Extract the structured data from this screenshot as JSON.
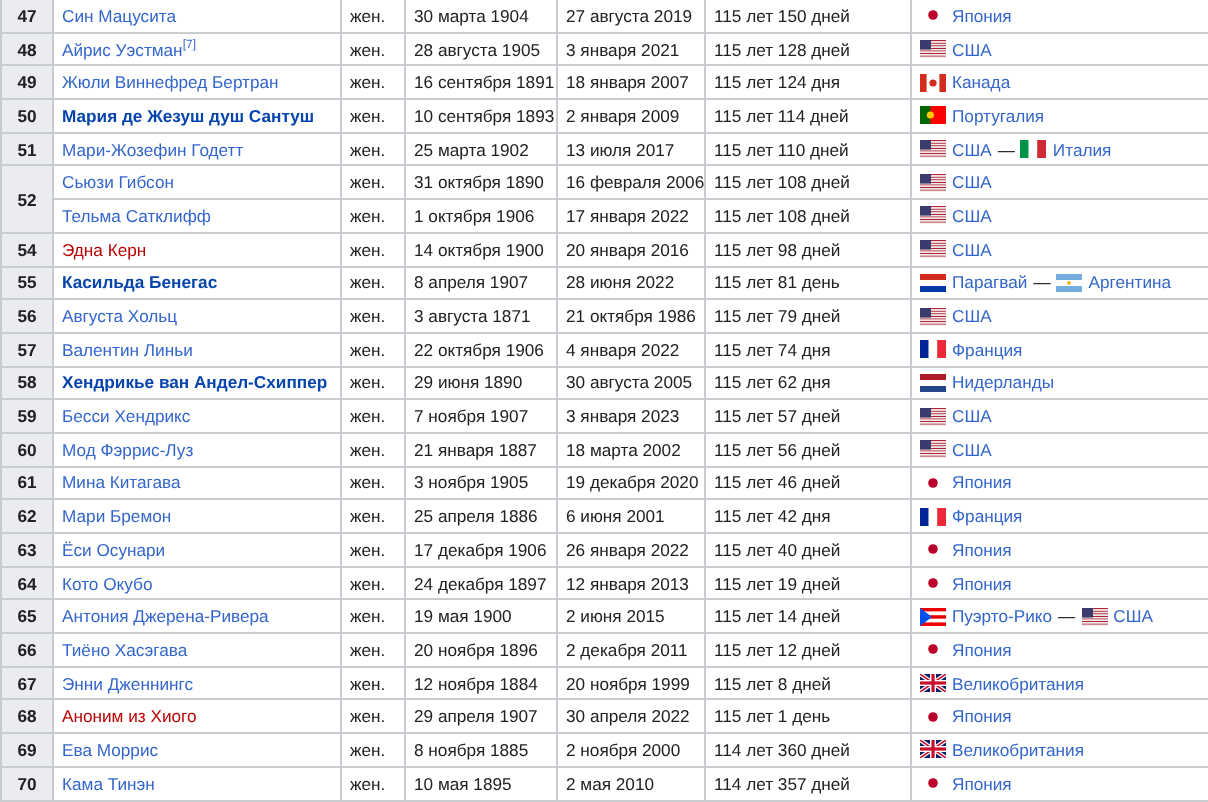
{
  "rows": [
    {
      "rank": "47",
      "people": [
        {
          "name": "Син Мацусита",
          "kind": "normal",
          "sex": "жен.",
          "born": "30 марта 1904",
          "died": "27 августа 2019",
          "age": "115 лет 150 дней",
          "countries": [
            {
              "kind": "japan",
              "name": "Япония"
            }
          ]
        }
      ]
    },
    {
      "rank": "48",
      "people": [
        {
          "name": "Айрис Уэстман$^{[7]}$",
          "kind": "normal",
          "sex": "жен.",
          "born": "28 августа 1905",
          "died": "3 января 2021",
          "age": "115 лет 128 дней",
          "countries": [
            {
              "kind": "usa",
              "name": "США"
            }
          ]
        }
      ]
    },
    {
      "rank": "49",
      "people": [
        {
          "name": "Жюли Виннефред Бертран",
          "kind": "normal",
          "sex": "жен.",
          "born": "16 сентября 1891",
          "died": "18 января 2007",
          "age": "115 лет 124 дня",
          "countries": [
            {
              "kind": "canada",
              "name": "Канада"
            }
          ]
        }
      ]
    },
    {
      "rank": "50",
      "people": [
        {
          "name": "Мария де Жезуш душ Сантуш",
          "kind": "highlighted",
          "sex": "жен.",
          "born": "10 сентября 1893",
          "died": "2 января 2009",
          "age": "115 лет 114 дней",
          "countries": [
            {
              "kind": "portugal",
              "name": "Португалия"
            }
          ]
        }
      ]
    },
    {
      "rank": "51",
      "people": [
        {
          "name": "Мари-Жозефин Годетт",
          "kind": "normal",
          "sex": "жен.",
          "born": "25 марта 1902",
          "died": "13 июля 2017",
          "age": "115 лет 110 дней",
          "countries": [
            {
              "kind": "usa",
              "name": "США"
            },
            {
              "separator": "—",
              "kind": "italy",
              "name": "Италия"
            }
          ]
        }
      ]
    },
    {
      "rank": "52",
      "people": [
        {
          "name": "Сьюзи Гибсон",
          "kind": "normal",
          "sex": "жен.",
          "born": "31 октября 1890",
          "died": "16 февраля 2006",
          "age": "115 лет 108 дней",
          "countries": [
            {
              "kind": "usa",
              "name": "США"
            }
          ]
        },
        {
          "name": "Тельма Сатклифф",
          "kind": "normal",
          "sex": "жен.",
          "born": "1 октября 1906",
          "died": "17 января 2022",
          "age": "115 лет 108 дней",
          "countries": [
            {
              "kind": "usa",
              "name": "США"
            }
          ]
        }
      ]
    },
    {
      "rank": "54",
      "people": [
        {
          "name": "Эдна Керн",
          "kind": "missing",
          "sex": "жен.",
          "born": "14 октября 1900",
          "died": "20 января 2016",
          "age": "115 лет 98 дней",
          "countries": [
            {
              "kind": "usa",
              "name": "США"
            }
          ]
        }
      ]
    },
    {
      "rank": "55",
      "people": [
        {
          "name": "Касильда Бенегас",
          "kind": "highlighted",
          "sex": "жен.",
          "born": "8 апреля 1907",
          "died": "28 июня 2022",
          "age": "115 лет 81 день",
          "countries": [
            {
              "kind": "paraguay",
              "name": "Парагвай"
            },
            {
              "separator": "—",
              "kind": "argentina",
              "name": "Аргентина"
            }
          ]
        }
      ]
    },
    {
      "rank": "56",
      "people": [
        {
          "name": "Августа Хольц",
          "kind": "normal",
          "sex": "жен.",
          "born": "3 августа 1871",
          "died": "21 октября 1986",
          "age": "115 лет 79 дней",
          "countries": [
            {
              "kind": "usa",
              "name": "США"
            }
          ]
        }
      ]
    },
    {
      "rank": "57",
      "people": [
        {
          "name": "Валентин Линьи",
          "kind": "normal",
          "sex": "жен.",
          "born": "22 октября 1906",
          "died": "4 января 2022",
          "age": "115 лет 74 дня",
          "countries": [
            {
              "kind": "france",
              "name": "Франция"
            }
          ]
        }
      ]
    },
    {
      "rank": "58",
      "people": [
        {
          "name": "Хендрикье ван Андел-Схиппер",
          "kind": "highlighted",
          "sex": "жен.",
          "born": "29 июня 1890",
          "died": "30 августа 2005",
          "age": "115 лет 62 дня",
          "countries": [
            {
              "kind": "netherlands",
              "name": "Нидерланды"
            }
          ]
        }
      ]
    },
    {
      "rank": "59",
      "people": [
        {
          "name": "Бесси Хендрикс",
          "kind": "normal",
          "sex": "жен.",
          "born": "7 ноября 1907",
          "died": "3 января 2023",
          "age": "115 лет 57 дней",
          "countries": [
            {
              "kind": "usa",
              "name": "США"
            }
          ]
        }
      ]
    },
    {
      "rank": "60",
      "people": [
        {
          "name": "Мод Фэррис-Луз",
          "kind": "normal",
          "sex": "жен.",
          "born": "21 января 1887",
          "died": "18 марта 2002",
          "age": "115 лет 56 дней",
          "countries": [
            {
              "kind": "usa",
              "name": "США"
            }
          ]
        }
      ]
    },
    {
      "rank": "61",
      "people": [
        {
          "name": "Мина Китагава",
          "kind": "normal",
          "sex": "жен.",
          "born": "3 ноября 1905",
          "died": "19 декабря 2020",
          "age": "115 лет 46 дней",
          "countries": [
            {
              "kind": "japan",
              "name": "Япония"
            }
          ]
        }
      ]
    },
    {
      "rank": "62",
      "people": [
        {
          "name": "Мари Бремон",
          "kind": "normal",
          "sex": "жен.",
          "born": "25 апреля 1886",
          "died": "6 июня 2001",
          "age": "115 лет 42 дня",
          "countries": [
            {
              "kind": "france",
              "name": "Франция"
            }
          ]
        }
      ]
    },
    {
      "rank": "63",
      "people": [
        {
          "name": "Ёси Осунари",
          "kind": "normal",
          "sex": "жен.",
          "born": "17 декабря 1906",
          "died": "26 января 2022",
          "age": "115 лет 40 дней",
          "countries": [
            {
              "kind": "japan",
              "name": "Япония"
            }
          ]
        }
      ]
    },
    {
      "rank": "64",
      "people": [
        {
          "name": "Кото Окубо",
          "kind": "normal",
          "sex": "жен.",
          "born": "24 декабря 1897",
          "died": "12 января 2013",
          "age": "115 лет 19 дней",
          "countries": [
            {
              "kind": "japan",
              "name": "Япония"
            }
          ]
        }
      ]
    },
    {
      "rank": "65",
      "people": [
        {
          "name": "Антония Джерена-Ривера",
          "kind": "normal",
          "sex": "жен.",
          "born": "19 мая 1900",
          "died": "2 июня 2015",
          "age": "115 лет 14 дней",
          "countries": [
            {
              "kind": "puerto_rico",
              "name": "Пуэрто-Рико"
            },
            {
              "separator": "—",
              "kind": "usa",
              "name": "США"
            }
          ]
        }
      ]
    },
    {
      "rank": "66",
      "people": [
        {
          "name": "Тиёно Хасэгава",
          "kind": "normal",
          "sex": "жен.",
          "born": "20 ноября 1896",
          "died": "2 декабря 2011",
          "age": "115 лет 12 дней",
          "countries": [
            {
              "kind": "japan",
              "name": "Япония"
            }
          ]
        }
      ]
    },
    {
      "rank": "67",
      "people": [
        {
          "name": "Энни Дженнингс",
          "kind": "normal",
          "sex": "жен.",
          "born": "12 ноября 1884",
          "died": "20 ноября 1999",
          "age": "115 лет 8 дней",
          "countries": [
            {
              "kind": "uk",
              "name": "Великобритания"
            }
          ]
        }
      ]
    },
    {
      "rank": "68",
      "people": [
        {
          "name": "Аноним из Хиого",
          "kind": "missing",
          "sex": "жен.",
          "born": "29 апреля 1907",
          "died": "30 апреля 2022",
          "age": "115 лет 1 день",
          "countries": [
            {
              "kind": "japan",
              "name": "Япония"
            }
          ]
        }
      ]
    },
    {
      "rank": "69",
      "people": [
        {
          "name": "Ева Моррис",
          "kind": "normal",
          "sex": "жен.",
          "born": "8 ноября 1885",
          "died": "2 ноября 2000",
          "age": "114 лет 360 дней",
          "countries": [
            {
              "kind": "uk",
              "name": "Великобритания"
            }
          ]
        }
      ]
    },
    {
      "rank": "70",
      "people": [
        {
          "name": "Кама Тинэн",
          "kind": "normal",
          "sex": "жен.",
          "born": "10 мая 1895",
          "died": "2 мая 2010",
          "age": "114 лет 357 дней",
          "countries": [
            {
              "kind": "japan",
              "name": "Япония"
            }
          ]
        }
      ]
    }
  ]
}
